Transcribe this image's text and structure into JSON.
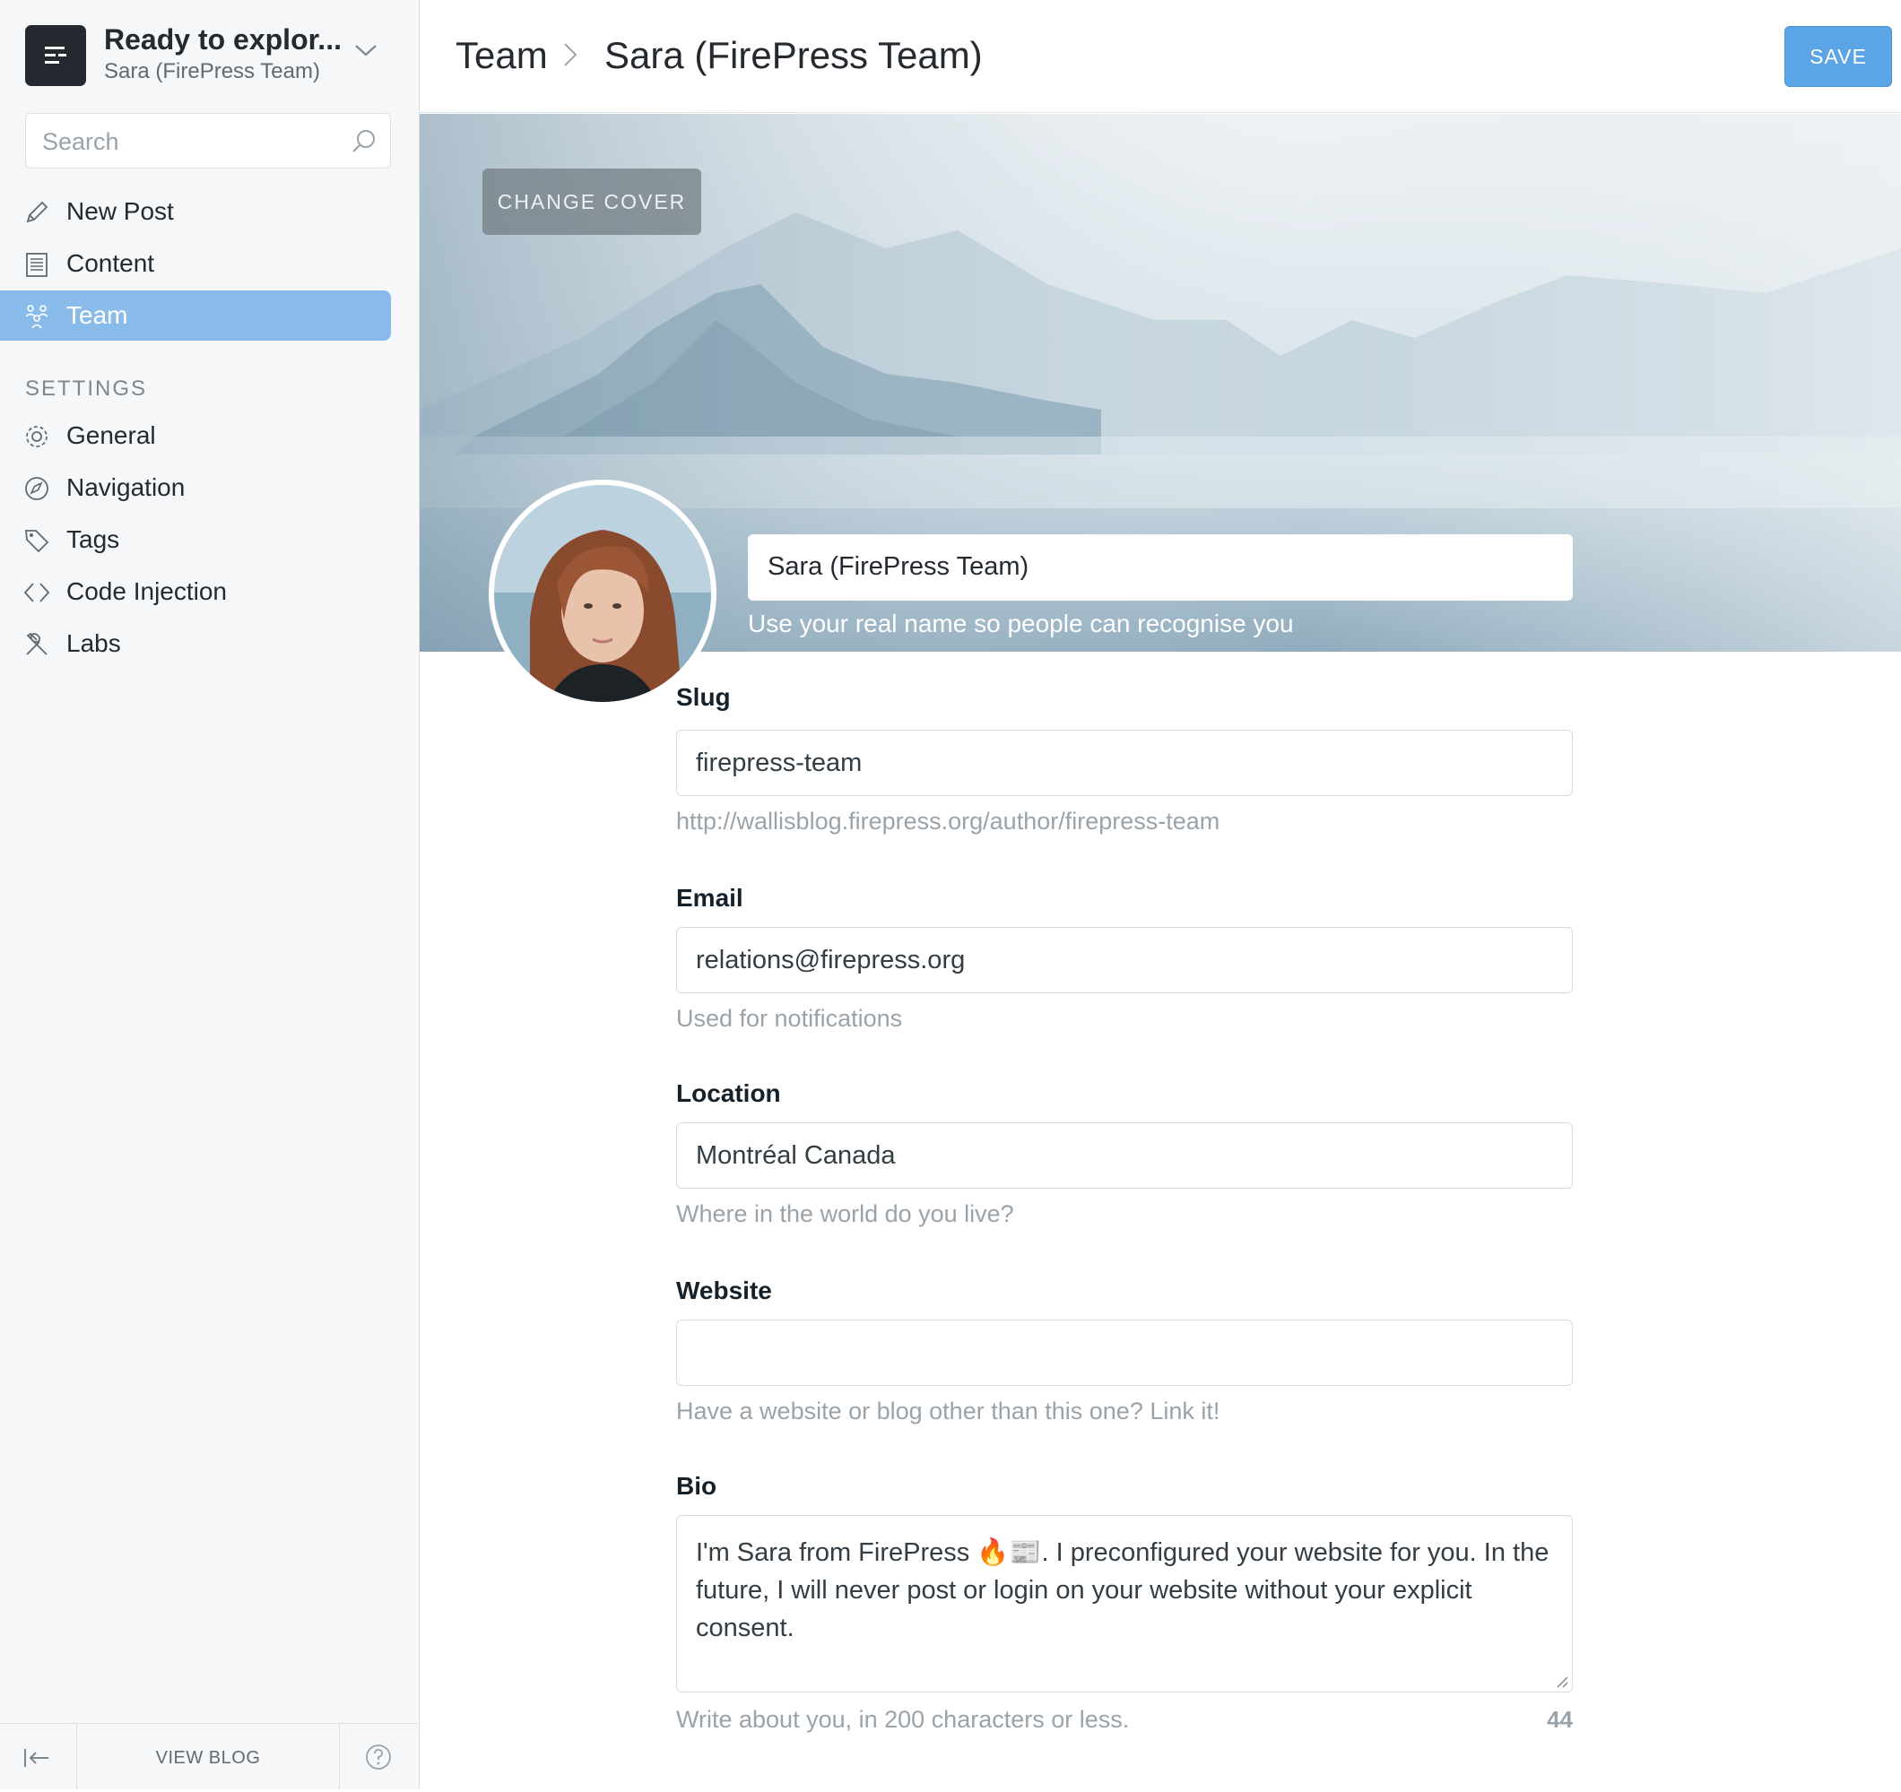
{
  "sidebar": {
    "blog_title": "Ready to explor...",
    "blog_user": "Sara (FirePress Team)",
    "search_placeholder": "Search",
    "nav": [
      {
        "label": "New Post",
        "icon": "pencil-icon"
      },
      {
        "label": "Content",
        "icon": "document-icon"
      },
      {
        "label": "Team",
        "icon": "team-icon",
        "active": true
      }
    ],
    "settings_label": "SETTINGS",
    "settings": [
      {
        "label": "General",
        "icon": "gear-icon"
      },
      {
        "label": "Navigation",
        "icon": "compass-icon"
      },
      {
        "label": "Tags",
        "icon": "tag-icon"
      },
      {
        "label": "Code Injection",
        "icon": "code-icon"
      },
      {
        "label": "Labs",
        "icon": "tools-icon"
      }
    ],
    "footer": {
      "view_blog": "VIEW BLOG"
    }
  },
  "header": {
    "crumb_root": "Team",
    "crumb_current": "Sara (FirePress Team)",
    "save_label": "SAVE"
  },
  "cover": {
    "change_cover_label": "CHANGE COVER",
    "name_value": "Sara (FirePress Team)",
    "name_hint": "Use your real name so people can recognise you"
  },
  "form": {
    "slug": {
      "label": "Slug",
      "value": "firepress-team",
      "hint": "http://wallisblog.firepress.org/author/firepress-team"
    },
    "email": {
      "label": "Email",
      "value": "relations@firepress.org",
      "hint": "Used for notifications"
    },
    "location": {
      "label": "Location",
      "value": "Montréal Canada",
      "hint": "Where in the world do you live?"
    },
    "website": {
      "label": "Website",
      "value": "",
      "hint": "Have a website or blog other than this one? Link it!"
    },
    "bio": {
      "label": "Bio",
      "value": "I'm Sara from FirePress 🔥📰. I preconfigured your website for you. In the future, I will never post or login on your website without your explicit consent.",
      "hint": "Write about you, in 200 characters or less.",
      "remaining": "44"
    }
  },
  "colors": {
    "accent": "#5ba4e5",
    "active_nav": "#89bbea",
    "sidebar_bg": "#f5f7f9"
  }
}
